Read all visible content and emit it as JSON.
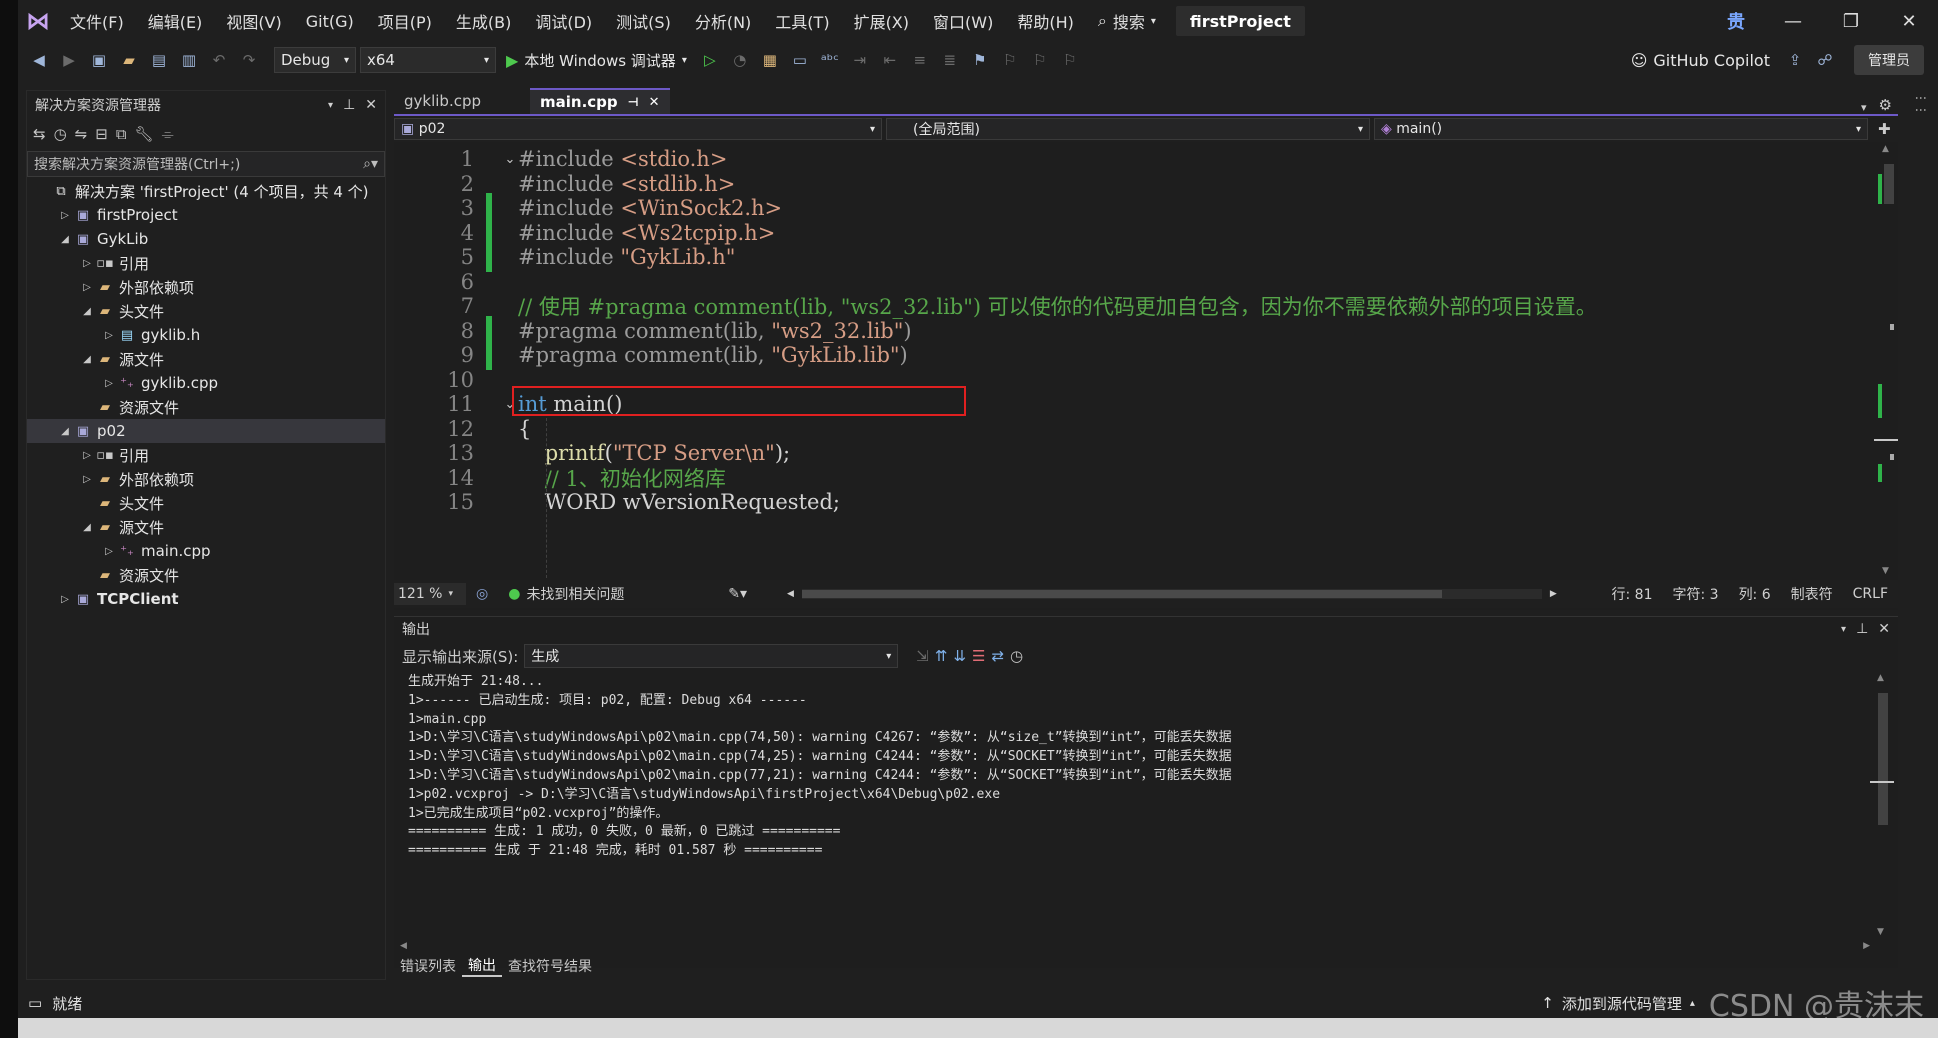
{
  "titlebar": {
    "menu": [
      "文件(F)",
      "编辑(E)",
      "视图(V)",
      "Git(G)",
      "项目(P)",
      "生成(B)",
      "调试(D)",
      "测试(S)",
      "分析(N)",
      "工具(T)",
      "扩展(X)",
      "窗口(W)",
      "帮助(H)"
    ],
    "search_label": "搜索",
    "project_name": "firstProject",
    "avatar_text": "贵"
  },
  "toolbar": {
    "config": "Debug",
    "platform": "x64",
    "run_label": "本地 Windows 调试器",
    "copilot_label": "GitHub Copilot",
    "admin_label": "管理员"
  },
  "solution_explorer": {
    "title": "解决方案资源管理器",
    "search_placeholder": "搜索解决方案资源管理器(Ctrl+;)",
    "items": [
      {
        "label": "解决方案 'firstProject' (4 个项目，共 4 个)",
        "level": 0,
        "expander": "",
        "icon": "solution"
      },
      {
        "label": "firstProject",
        "level": 1,
        "expander": "collapsed",
        "icon": "proj"
      },
      {
        "label": "GykLib",
        "level": 1,
        "expander": "expanded",
        "icon": "proj"
      },
      {
        "label": "引用",
        "level": 2,
        "expander": "collapsed",
        "icon": "ref"
      },
      {
        "label": "外部依赖项",
        "level": 2,
        "expander": "collapsed",
        "icon": "folder"
      },
      {
        "label": "头文件",
        "level": 2,
        "expander": "expanded",
        "icon": "folder"
      },
      {
        "label": "gyklib.h",
        "level": 3,
        "expander": "collapsed",
        "icon": "file"
      },
      {
        "label": "源文件",
        "level": 2,
        "expander": "expanded",
        "icon": "folder"
      },
      {
        "label": "gyklib.cpp",
        "level": 3,
        "expander": "collapsed",
        "icon": "cpp"
      },
      {
        "label": "资源文件",
        "level": 2,
        "expander": "",
        "icon": "folder"
      },
      {
        "label": "p02",
        "level": 1,
        "expander": "expanded",
        "icon": "proj",
        "selected": true
      },
      {
        "label": "引用",
        "level": 2,
        "expander": "collapsed",
        "icon": "ref"
      },
      {
        "label": "外部依赖项",
        "level": 2,
        "expander": "collapsed",
        "icon": "folder"
      },
      {
        "label": "头文件",
        "level": 2,
        "expander": "",
        "icon": "folder"
      },
      {
        "label": "源文件",
        "level": 2,
        "expander": "expanded",
        "icon": "folder"
      },
      {
        "label": "main.cpp",
        "level": 3,
        "expander": "collapsed",
        "icon": "cpp"
      },
      {
        "label": "资源文件",
        "level": 2,
        "expander": "",
        "icon": "folder"
      },
      {
        "label": "TCPClient",
        "level": 1,
        "expander": "collapsed",
        "icon": "proj",
        "bold": true
      }
    ]
  },
  "editor": {
    "tabs": [
      {
        "label": "gyklib.cpp",
        "active": false
      },
      {
        "label": "main.cpp",
        "active": true
      }
    ],
    "nav": {
      "project": "p02",
      "scope": "(全局范围)",
      "member": "main()"
    },
    "lines": [
      {
        "n": "1",
        "fold": "v",
        "changed": false,
        "parts": [
          {
            "t": "#include ",
            "c": "pp"
          },
          {
            "t": "<stdio.h>",
            "c": "str"
          }
        ]
      },
      {
        "n": "2",
        "fold": "",
        "changed": false,
        "parts": [
          {
            "t": "#include ",
            "c": "pp"
          },
          {
            "t": "<stdlib.h>",
            "c": "str"
          }
        ]
      },
      {
        "n": "3",
        "fold": "",
        "changed": true,
        "parts": [
          {
            "t": "#include ",
            "c": "pp"
          },
          {
            "t": "<WinSock2.h>",
            "c": "str"
          }
        ]
      },
      {
        "n": "4",
        "fold": "",
        "changed": true,
        "parts": [
          {
            "t": "#include ",
            "c": "pp"
          },
          {
            "t": "<Ws2tcpip.h>",
            "c": "str"
          }
        ]
      },
      {
        "n": "5",
        "fold": "",
        "changed": true,
        "parts": [
          {
            "t": "#include ",
            "c": "pp"
          },
          {
            "t": "\"GykLib.h\"",
            "c": "str"
          }
        ]
      },
      {
        "n": "6",
        "fold": "",
        "changed": false,
        "parts": []
      },
      {
        "n": "7",
        "fold": "",
        "changed": false,
        "parts": [
          {
            "t": "// 使用 #pragma comment(lib, \"ws2_32.lib\") 可以使你的代码更加自包含，因为你不需要依赖外部的项目设置。",
            "c": "cmt"
          }
        ]
      },
      {
        "n": "8",
        "fold": "",
        "changed": true,
        "parts": [
          {
            "t": "#pragma comment(lib, ",
            "c": "pp"
          },
          {
            "t": "\"ws2_32.lib\"",
            "c": "str"
          },
          {
            "t": ")",
            "c": "pp"
          }
        ]
      },
      {
        "n": "9",
        "fold": "",
        "changed": true,
        "parts": [
          {
            "t": "#pragma comment(lib, ",
            "c": "pp"
          },
          {
            "t": "\"GykLib.lib\"",
            "c": "str"
          },
          {
            "t": ")",
            "c": "pp"
          }
        ]
      },
      {
        "n": "10",
        "fold": "",
        "changed": false,
        "parts": []
      },
      {
        "n": "11",
        "fold": "v",
        "changed": false,
        "parts": [
          {
            "t": "int",
            "c": "kw"
          },
          {
            "t": " main()",
            "c": "plain"
          }
        ]
      },
      {
        "n": "12",
        "fold": "",
        "changed": false,
        "parts": [
          {
            "t": "{",
            "c": "plain"
          }
        ]
      },
      {
        "n": "13",
        "fold": "",
        "changed": false,
        "parts": [
          {
            "t": "    ",
            "c": "plain"
          },
          {
            "t": "printf",
            "c": "fn"
          },
          {
            "t": "(",
            "c": "plain"
          },
          {
            "t": "\"TCP Server\\n\"",
            "c": "str"
          },
          {
            "t": ");",
            "c": "plain"
          }
        ]
      },
      {
        "n": "14",
        "fold": "",
        "changed": false,
        "parts": [
          {
            "t": "    // 1、初始化网络库",
            "c": "cmt"
          }
        ]
      },
      {
        "n": "15",
        "fold": "",
        "changed": false,
        "parts": [
          {
            "t": "    WORD wVersionRequested;",
            "c": "plain"
          }
        ]
      }
    ],
    "status": {
      "zoom": "121 %",
      "issues": "未找到相关问题",
      "line": "行: 81",
      "char": "字符: 3",
      "col": "列: 6",
      "tabs": "制表符",
      "eol": "CRLF"
    }
  },
  "output": {
    "title": "输出",
    "source_label": "显示输出来源(S):",
    "source_value": "生成",
    "lines": [
      "生成开始于 21:48...",
      "1>------ 已启动生成: 项目: p02, 配置: Debug x64 ------",
      "1>main.cpp",
      "1>D:\\学习\\C语言\\studyWindowsApi\\p02\\main.cpp(74,50): warning C4267: “参数”: 从“size_t”转换到“int”，可能丢失数据",
      "1>D:\\学习\\C语言\\studyWindowsApi\\p02\\main.cpp(74,25): warning C4244: “参数”: 从“SOCKET”转换到“int”，可能丢失数据",
      "1>D:\\学习\\C语言\\studyWindowsApi\\p02\\main.cpp(77,21): warning C4244: “参数”: 从“SOCKET”转换到“int”，可能丢失数据",
      "1>p02.vcxproj -> D:\\学习\\C语言\\studyWindowsApi\\firstProject\\x64\\Debug\\p02.exe",
      "1>已完成生成项目“p02.vcxproj”的操作。",
      "========== 生成: 1 成功，0 失败，0 最新，0 已跳过 ==========",
      "========== 生成 于 21:48 完成，耗时 01.587 秒 =========="
    ],
    "tabs": [
      "错误列表",
      "输出",
      "查找符号结果"
    ],
    "active_tab": "输出"
  },
  "statusbar": {
    "ready": "就绪",
    "source_control": "添加到源代码管理",
    "watermark": "CSDN @贵沫末"
  }
}
